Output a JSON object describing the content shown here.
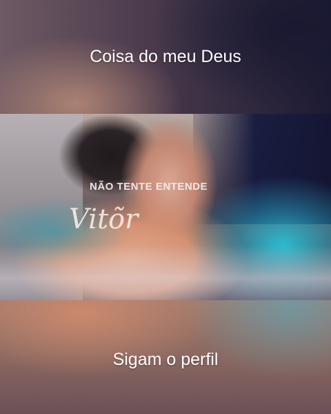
{
  "captions": {
    "top": "Coisa do meu Deus",
    "bottom": "Sigam o perfil"
  },
  "video": {
    "overlay_title": "NÃO TENTE ENTENDE",
    "overlay_script": "Vitõr"
  }
}
